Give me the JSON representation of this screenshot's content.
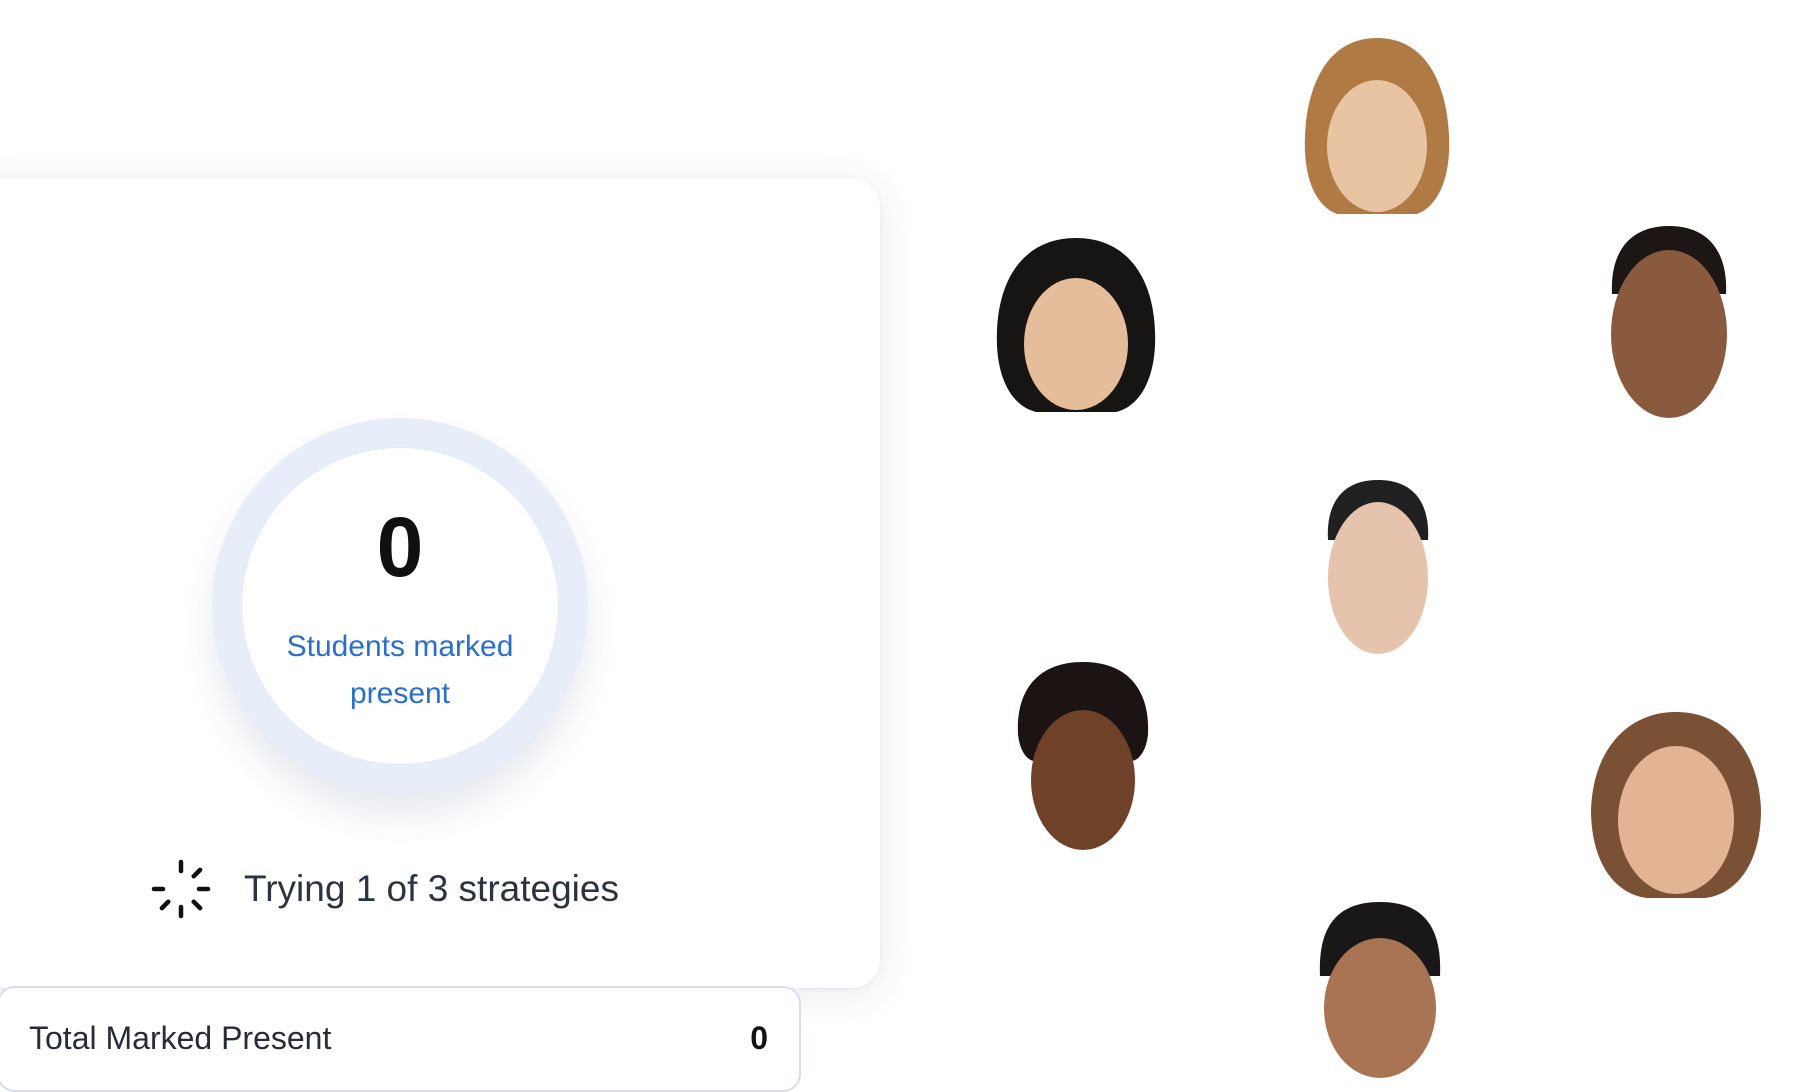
{
  "attendance": {
    "count": "0",
    "count_caption": "Students marked present",
    "status_text": "Trying 1 of 3 strategies",
    "total_label": "Total Marked Present",
    "total_value": "0"
  },
  "icons": {
    "spinner": "loading-spinner-icon"
  },
  "colors": {
    "accent": "#2a6fc9",
    "ring": "#e7eef9",
    "border": "#d7dee8"
  },
  "faces": [
    {
      "name": "face-1",
      "hair": "#b07a45",
      "skin": "#e9c4a2"
    },
    {
      "name": "face-2",
      "hair": "#171414",
      "skin": "#e5bd9a"
    },
    {
      "name": "face-3",
      "hair": "#1c1614",
      "skin": "#8a5a3e"
    },
    {
      "name": "face-4",
      "hair": "#202020",
      "skin": "#e6c3ac"
    },
    {
      "name": "face-5",
      "hair": "#1b1412",
      "skin": "#6e4128"
    },
    {
      "name": "face-6",
      "hair": "#7a5134",
      "skin": "#e2b494"
    },
    {
      "name": "face-7",
      "hair": "#1a1718",
      "skin": "#a87454"
    }
  ]
}
